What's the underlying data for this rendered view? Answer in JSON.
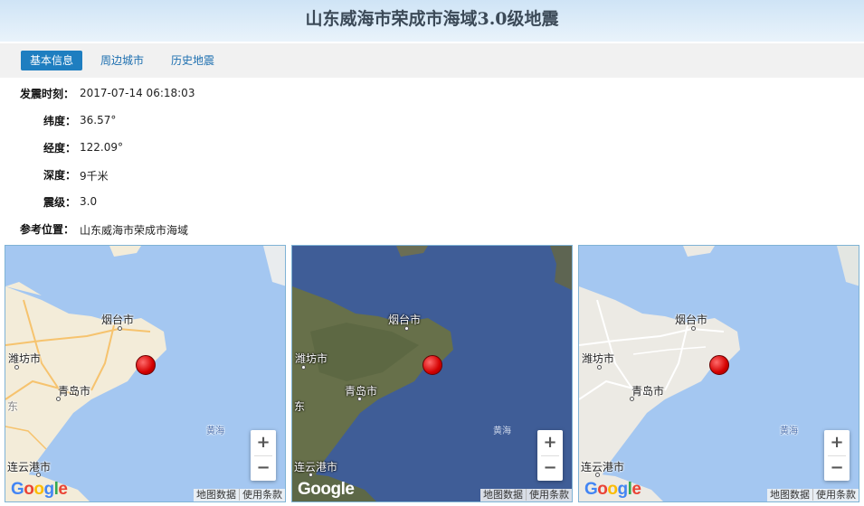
{
  "title": "山东威海市荣成市海域3.0级地震",
  "tabs": [
    {
      "label": "基本信息",
      "active": true
    },
    {
      "label": "周边城市",
      "active": false
    },
    {
      "label": "历史地震",
      "active": false
    }
  ],
  "info": [
    {
      "key": "发震时刻：",
      "value": "2017-07-14 06:18:03"
    },
    {
      "key": "纬度：",
      "value": "36.57°"
    },
    {
      "key": "经度：",
      "value": "122.09°"
    },
    {
      "key": "深度：",
      "value": "9千米"
    },
    {
      "key": "震级：",
      "value": "3.0"
    },
    {
      "key": "参考位置：",
      "value": "山东威海市荣成市海域"
    }
  ],
  "map": {
    "cities": {
      "yantai": "烟台市",
      "weifang": "潍坊市",
      "qingdao": "青岛市",
      "lianyungang": "连云港市",
      "dong": "东"
    },
    "sea": "黄海",
    "zoom_in": "+",
    "zoom_out": "−",
    "attr_data": "地图数据",
    "attr_terms": "使用条款",
    "logo": "Google",
    "colors": {
      "sea": "#a4c7f1",
      "land_road": "#f3ecd9",
      "land_terrain": "#eceae4",
      "sat_sea": "#3f5d97",
      "sat_land": "#67704a",
      "marker": "#e00000"
    }
  }
}
